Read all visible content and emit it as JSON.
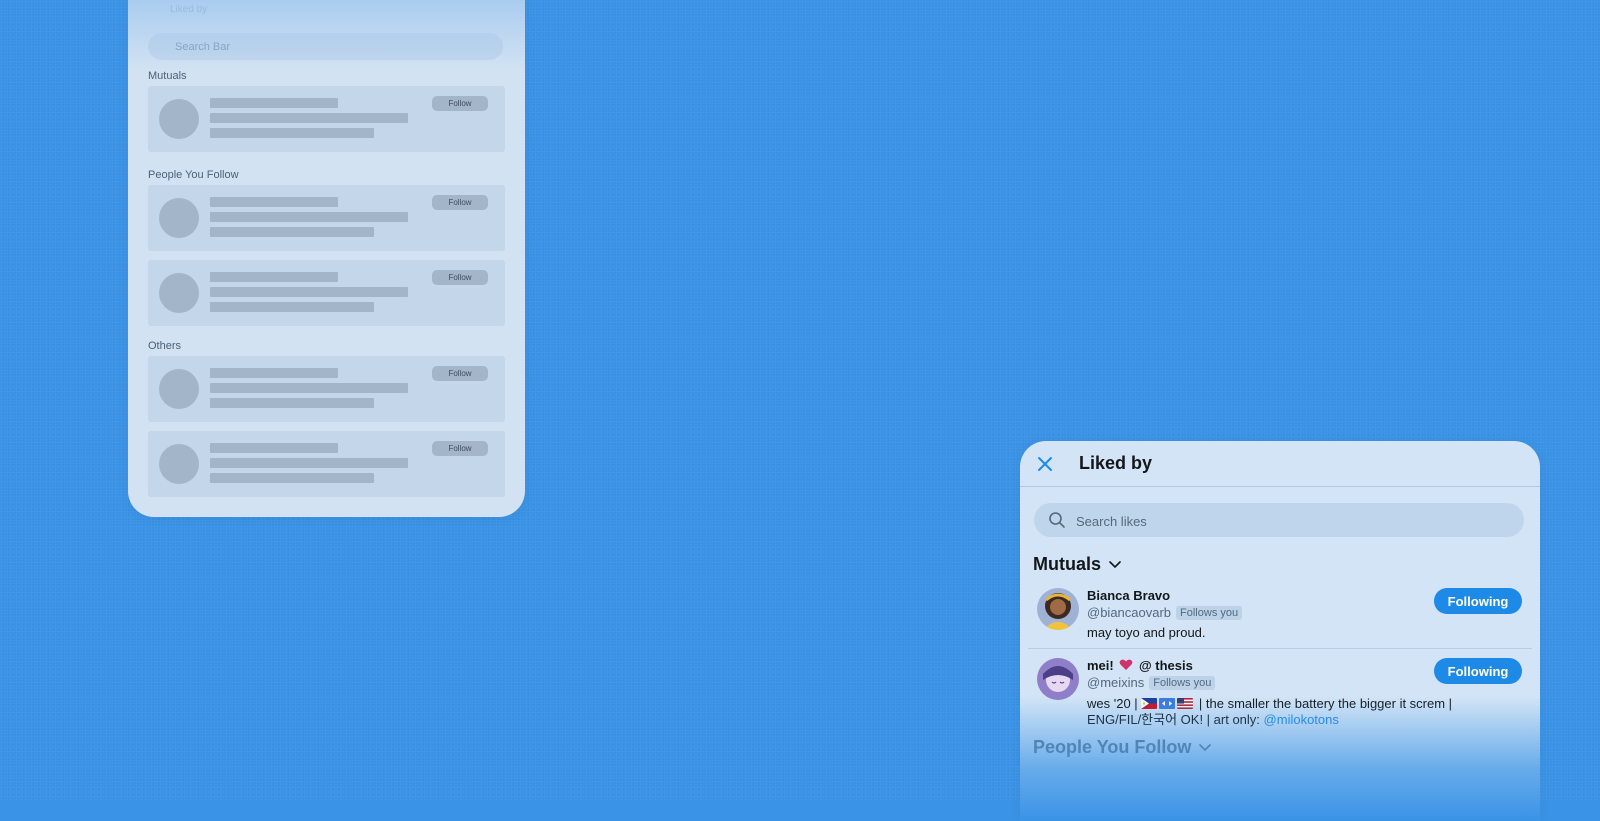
{
  "wireframe": {
    "cutoff_text": "Liked by",
    "search_placeholder": "Search Bar",
    "sections": [
      {
        "heading": "Mutuals",
        "cards": [
          {
            "button": "Follow"
          }
        ]
      },
      {
        "heading": "People You Follow",
        "cards": [
          {
            "button": "Follow"
          },
          {
            "button": "Follow"
          }
        ]
      },
      {
        "heading": "Others",
        "cards": [
          {
            "button": "Follow"
          },
          {
            "button": "Follow"
          }
        ]
      }
    ]
  },
  "liked_by": {
    "title": "Liked by",
    "close_icon": "close-icon",
    "search": {
      "placeholder": "Search likes",
      "value": "",
      "icon": "search-icon"
    },
    "sections": [
      {
        "label": "Mutuals",
        "icon": "chevron-down-icon"
      },
      {
        "label": "People You Follow",
        "icon": "chevron-down-icon"
      }
    ],
    "users": [
      {
        "name": "Bianca Bravo",
        "handle": "@biancaovarb",
        "badge": "Follows you",
        "bio": "may toyo and proud.",
        "button": "Following"
      },
      {
        "name_prefix": "mei!",
        "name_icon": "heart-emoji",
        "name_suffix": "@ thesis",
        "handle": "@meixins",
        "badge": "Follows you",
        "bio_prefix": "wes '20 |",
        "bio_flags": [
          "philippines-flag",
          "korea-flag",
          "usa-flag"
        ],
        "bio_suffix": "| the smaller the battery the bigger it screm |",
        "bio_line2": "ENG/FIL/한국어 OK! | art only:",
        "bio_link": "@milokotons",
        "button": "Following"
      }
    ]
  },
  "colors": {
    "background": "#3a93e6",
    "accent": "#1d8ae8",
    "panel": "#d2e4f6",
    "wireframe_panel": "#d2e2f3",
    "wireframe_placeholder": "#a3b5c9"
  }
}
